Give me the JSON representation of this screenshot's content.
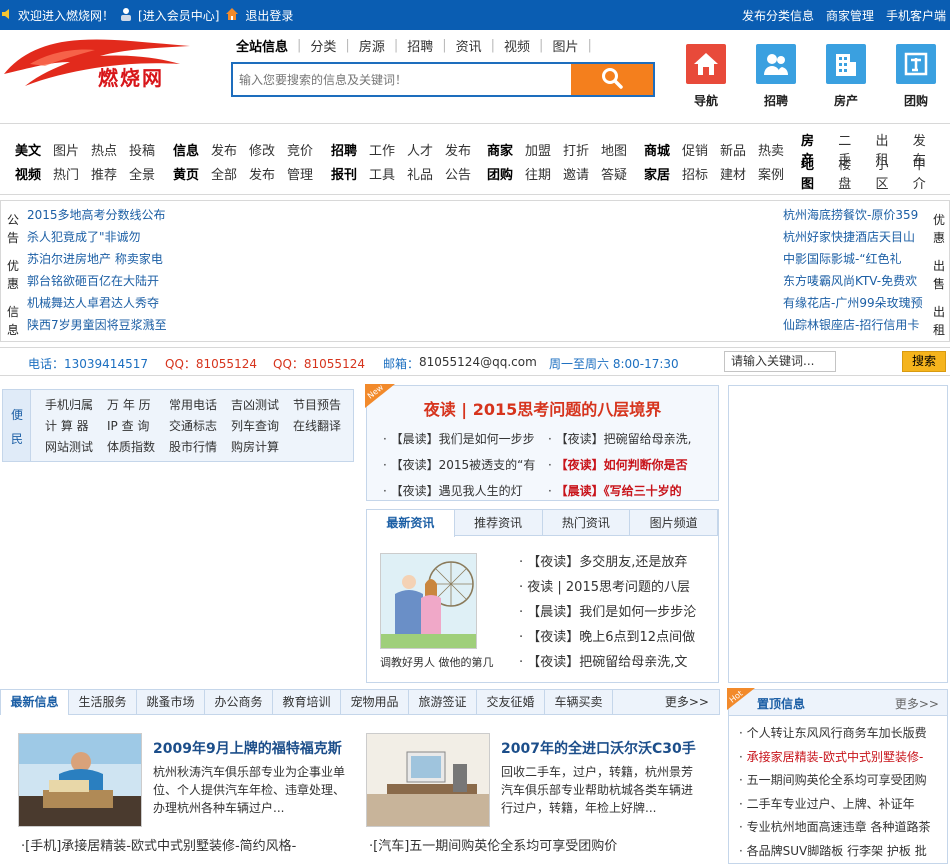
{
  "topbar": {
    "welcome": "欢迎进入燃烧网！",
    "member_center": "[进入会员中心]",
    "logout": "退出登录",
    "right_links": [
      "发布分类信息",
      "商家管理",
      "手机客户端"
    ]
  },
  "logo": {
    "text": "燃烧网"
  },
  "search": {
    "tabs": [
      "全站信息",
      "分类",
      "房源",
      "招聘",
      "资讯",
      "视频",
      "图片"
    ],
    "placeholder": "输入您要搜索的信息及关键词！"
  },
  "quick_icons": [
    {
      "label": "导航",
      "icon": "home-icon",
      "color": "#e84a3a"
    },
    {
      "label": "招聘",
      "icon": "users-icon",
      "color": "#3aa0e0"
    },
    {
      "label": "房产",
      "icon": "building-icon",
      "color": "#3aa0e0"
    },
    {
      "label": "团购",
      "icon": "group-icon",
      "color": "#3aa0e0"
    }
  ],
  "nav": [
    {
      "rows": [
        [
          "美文",
          "图片",
          "热点",
          "投稿"
        ],
        [
          "视频",
          "热门",
          "推荐",
          "全景"
        ]
      ]
    },
    {
      "rows": [
        [
          "信息",
          "发布",
          "修改",
          "竞价"
        ],
        [
          "黄页",
          "全部",
          "发布",
          "管理"
        ]
      ]
    },
    {
      "rows": [
        [
          "招聘",
          "工作",
          "人才",
          "发布"
        ],
        [
          "报刊",
          "工具",
          "礼品",
          "公告"
        ]
      ]
    },
    {
      "rows": [
        [
          "商家",
          "加盟",
          "打折",
          "地图"
        ],
        [
          "团购",
          "往期",
          "邀请",
          "答疑"
        ]
      ]
    },
    {
      "rows": [
        [
          "商城",
          "促销",
          "新品",
          "热卖"
        ],
        [
          "家居",
          "招标",
          "建材",
          "案例"
        ]
      ]
    },
    {
      "rows": [
        [
          "房产",
          "二手",
          "出租",
          "发布"
        ],
        [
          "地图",
          "楼盘",
          "小区",
          "中介"
        ]
      ]
    }
  ],
  "notices": {
    "left_labels": [
      "公告",
      "优惠",
      "信息"
    ],
    "right_labels": [
      "优惠",
      "出售",
      "出租"
    ],
    "left": [
      "2015多地高考分数线公布",
      "杀人犯竟成了\"非诚勿",
      "苏泊尔进房地产 称卖家电",
      "郭台铭欲砸百亿在大陆开",
      "机械舞达人卓君达人秀夺",
      "陕西7岁男童因将豆浆溅至"
    ],
    "right": [
      "杭州海底捞餐饮-原价359",
      "杭州好家快捷酒店天目山",
      "中影国际影城-“红色礼",
      "东方唛霸风尚KTV-免费欢",
      "有缘花店-广州99朵玫瑰预",
      "仙踪林银座店-招行信用卡"
    ]
  },
  "contact": {
    "phone": "电话：13039414517",
    "qq1": "QQ：81055124",
    "qq2": "QQ：81055124",
    "email_label": "邮箱：",
    "email": "81055124@qq.com",
    "hours": "周一至周六 8:00-17:30",
    "keyword_placeholder": "请输入关键词...",
    "search_btn": "搜索"
  },
  "convenience": {
    "label": [
      "便",
      "民"
    ],
    "rows": [
      [
        "手机归属",
        "万 年 历",
        "常用电话",
        "吉凶测试",
        "节目预告"
      ],
      [
        "计 算 器",
        "IP 查 询",
        "交通标志",
        "列车查询",
        "在线翻译"
      ],
      [
        "网站测试",
        "体质指数",
        "股市行情",
        "购房计算"
      ]
    ]
  },
  "featured": {
    "badge": "New",
    "title": "夜读 | 2015思考问题的八层境界",
    "items": [
      {
        "text": "【晨读】我们是如何一步步",
        "hl": false
      },
      {
        "text": "【夜读】把碗留给母亲洗,",
        "hl": false
      },
      {
        "text": "【夜读】2015被透支的“有",
        "hl": false
      },
      {
        "text": "【夜读】如何判断你是否",
        "hl": true
      },
      {
        "text": "【夜读】遇见我人生的灯",
        "hl": false
      },
      {
        "text": "【晨读】《写给三十岁的",
        "hl": true
      }
    ]
  },
  "news_tabs": {
    "tabs": [
      "最新资讯",
      "推荐资讯",
      "热门资讯",
      "图片频道"
    ],
    "caption": "调教好男人 做他的第几",
    "items": [
      "【夜读】多交朋友,还是放弃",
      "夜读 | 2015思考问题的八层",
      "【晨读】我们是如何一步步沦",
      "【夜读】晚上6点到12点间做",
      "【夜读】把碗留给母亲洗,文"
    ]
  },
  "bottom_tabs": {
    "tabs": [
      "最新信息",
      "生活服务",
      "跳蚤市场",
      "办公商务",
      "教育培训",
      "宠物用品",
      "旅游签证",
      "交友征婚",
      "车辆买卖"
    ],
    "more": "更多>>"
  },
  "articles": [
    {
      "title": "2009年9月上牌的福特福克斯",
      "desc": "杭州秋涛汽车俱乐部专业为企事业单位、个人提供汽车年检、违章处理、办理杭州各种车辆过户...",
      "link": "·[手机]承接居精装-欧式中式别墅装修-简约风格-"
    },
    {
      "title": "2007年的全进口沃尔沃C30手",
      "desc": "回收二手车，过户，转籍，杭州景芳汽车俱乐部专业帮助杭城各类车辆进行过户，转籍，年检上好牌...",
      "link": "·[汽车]五一期间购英伦全系均可享受团购价"
    }
  ],
  "pinned": {
    "badge": "Hot",
    "title": "置顶信息",
    "more": "更多>>",
    "items": [
      {
        "text": "个人转让东风风行商务车加长版费",
        "hl": false
      },
      {
        "text": "承接家居精装-欧式中式别墅装修-",
        "hl": true
      },
      {
        "text": "五一期间购英伦全系均可享受团购",
        "hl": false
      },
      {
        "text": "二手车专业过户、上牌、补证年",
        "hl": false
      },
      {
        "text": "专业杭州地面高速违章 各种道路茶",
        "hl": false
      },
      {
        "text": "各品牌SUV脚踏板 行李架 护板 批",
        "hl": false
      }
    ]
  }
}
